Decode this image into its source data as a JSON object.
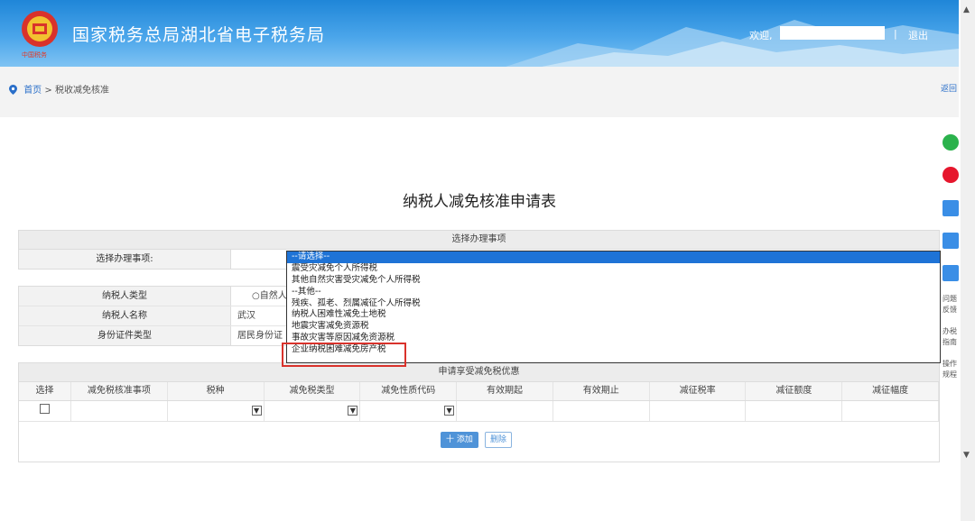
{
  "header": {
    "site_title": "国家税务总局湖北省电子税务局",
    "emblem_caption": "中国税务",
    "welcome": "欢迎,",
    "separator": "|",
    "logout": "退出",
    "gradient_top": "#1f86d8",
    "gradient_bottom": "#7fc3f3"
  },
  "breadcrumb": {
    "home": "首页",
    "arrow": ">",
    "current": "税收减免核准",
    "back": "返回"
  },
  "side_tools": {
    "items": [
      {
        "icon": "wechat-icon",
        "color": "#2bb24c"
      },
      {
        "icon": "weibo-icon",
        "color": "#e6162d"
      },
      {
        "icon": "app-icon",
        "color": "#3a8ee6"
      },
      {
        "icon": "app-icon",
        "color": "#3a8ee6"
      },
      {
        "icon": "app-icon",
        "color": "#3a8ee6"
      }
    ],
    "labels": [
      "问题反馈",
      "办税指南",
      "操作规程"
    ]
  },
  "form": {
    "title": "纳税人减免核准申请表",
    "section1_head": "选择办理事项",
    "matter_label": "选择办理事项:",
    "taxpayer_type_label": "纳税人类型",
    "taxpayer_type_value": "○自然人",
    "taxpayer_name_label": "纳税人名称",
    "taxpayer_name_value": "武汉",
    "id_type_label": "身份证件类型",
    "id_type_value": "居民身份证",
    "section3_head": "申请享受减免税优惠",
    "columns": [
      "选择",
      "减免税核准事项",
      "税种",
      "减免税类型",
      "减免性质代码",
      "有效期起",
      "有效期止",
      "减征税率",
      "减征额度",
      "减征幅度"
    ],
    "add_button": "十 添加",
    "delete_button": "删除"
  },
  "dropdown": {
    "selected_index": 0,
    "options": [
      "--请选择--",
      "震受灾减免个人所得税",
      "其他自然灾害受灾减免个人所得税",
      "--其他--",
      "残疾、孤老、烈属减征个人所得税",
      "纳税人困难性减免土地税",
      "地震灾害减免资源税",
      "事故灾害等原因减免资源税",
      "企业纳税困难减免房产税"
    ],
    "highlight_color": "#d9322b",
    "selected_color": "#1e73d6"
  }
}
